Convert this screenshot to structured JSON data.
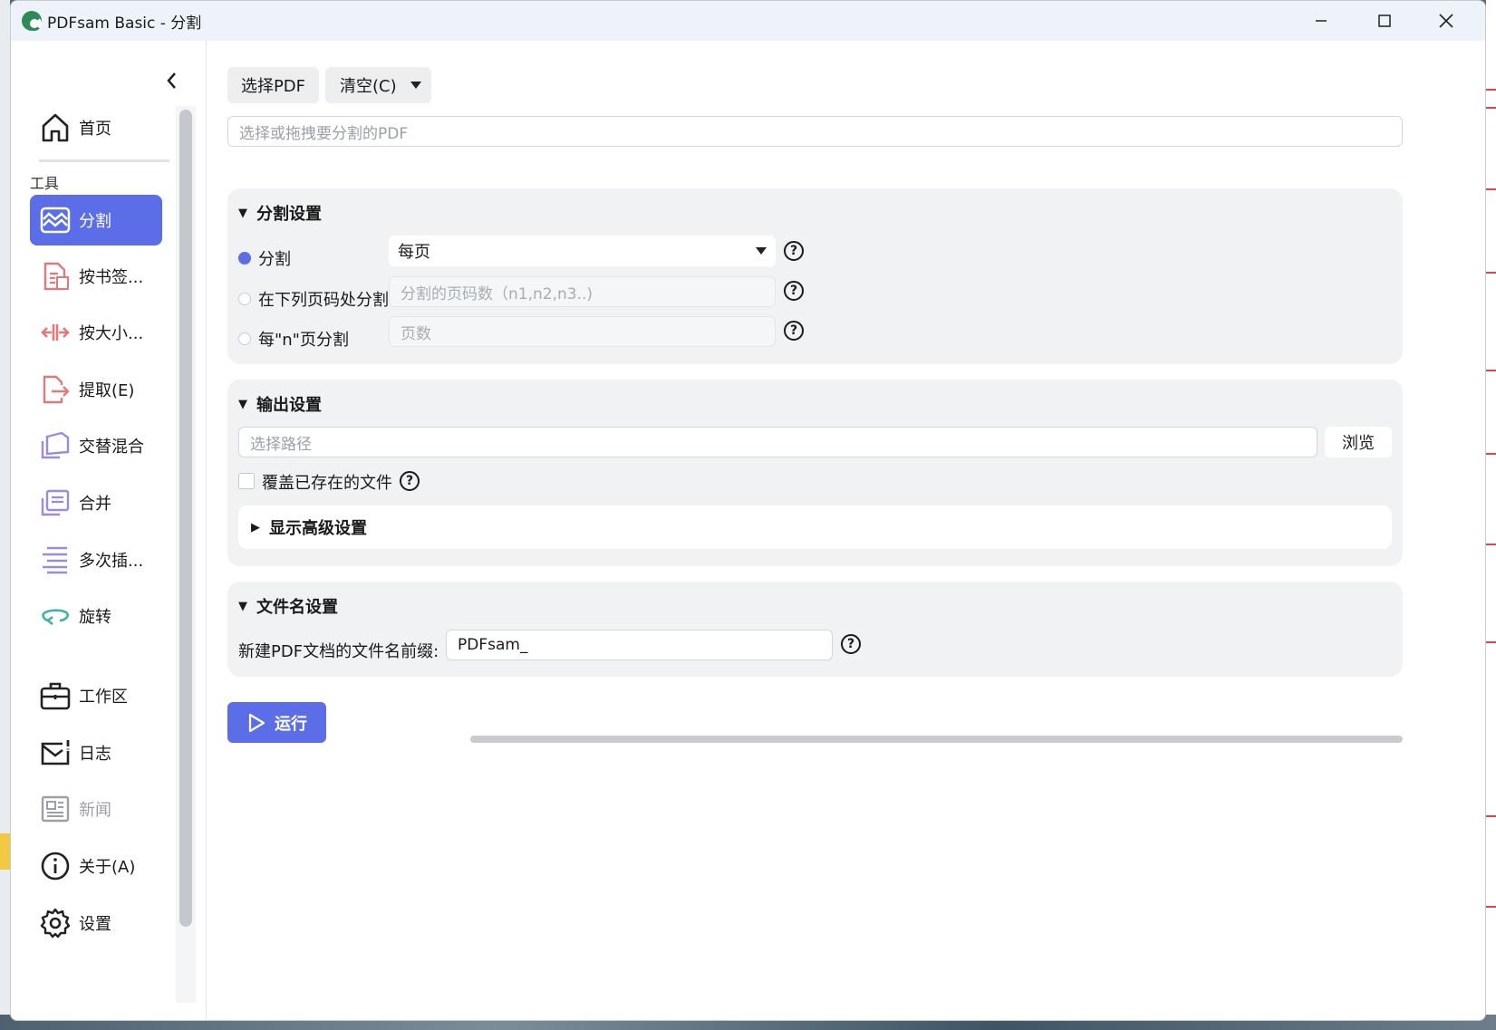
{
  "window": {
    "title": "PDFsam Basic - 分割",
    "minimize": "—",
    "maximize": "☐",
    "close": "✕"
  },
  "sidebar": {
    "home_label": "首页",
    "tools_section": "工具",
    "items": [
      {
        "label": "分割",
        "icon": "split-icon",
        "active": true
      },
      {
        "label": "按书签...",
        "icon": "bookmark-split-icon"
      },
      {
        "label": "按大小...",
        "icon": "size-split-icon"
      },
      {
        "label": "提取(E)",
        "icon": "extract-icon"
      },
      {
        "label": "交替混合",
        "icon": "alternate-mix-icon"
      },
      {
        "label": "合并",
        "icon": "merge-icon"
      },
      {
        "label": "多次插...",
        "icon": "multi-insert-icon"
      },
      {
        "label": "旋转",
        "icon": "rotate-icon"
      }
    ],
    "bottom_items": [
      {
        "label": "工作区",
        "icon": "workspace-icon"
      },
      {
        "label": "日志",
        "icon": "log-icon"
      },
      {
        "label": "新闻",
        "icon": "news-icon",
        "disabled": true
      },
      {
        "label": "关于(A)",
        "icon": "info-icon"
      },
      {
        "label": "设置",
        "icon": "gear-icon"
      }
    ]
  },
  "toolbar": {
    "select_pdf": "选择PDF",
    "clear": "清空(C)"
  },
  "pdf_input": {
    "placeholder": "选择或拖拽要分割的PDF"
  },
  "split_settings": {
    "title": "分割设置",
    "option_split": "分割",
    "split_select_value": "每页",
    "option_pages": "在下列页码处分割",
    "pages_placeholder": "分割的页码数（n1,n2,n3..)",
    "option_every_n": "每\"n\"页分割",
    "every_n_placeholder": "页数"
  },
  "output_settings": {
    "title": "输出设置",
    "path_placeholder": "选择路径",
    "browse": "浏览",
    "overwrite_label": "覆盖已存在的文件",
    "advanced": "显示高级设置"
  },
  "filename_settings": {
    "title": "文件名设置",
    "prefix_label": "新建PDF文档的文件名前缀:",
    "prefix_value": "PDFsam_"
  },
  "run": {
    "label": "运行"
  },
  "colors": {
    "accent": "#5b6ee8",
    "panel_bg": "#f1f2f4",
    "icon_red": "#e07a7a",
    "icon_purple": "#9a8be0",
    "icon_teal": "#3fb0a8"
  }
}
